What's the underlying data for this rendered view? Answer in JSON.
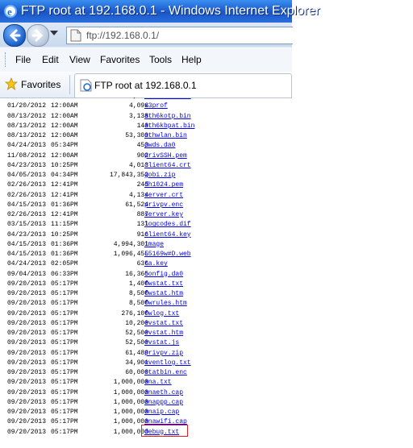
{
  "window": {
    "title": "FTP root at 192.168.0.1 - Windows Internet Explorer"
  },
  "address_bar": {
    "url": "ftp://192.168.0.1/"
  },
  "menu": [
    "File",
    "Edit",
    "View",
    "Favorites",
    "Tools",
    "Help"
  ],
  "favorites_bar": {
    "favorites_label": "Favorites"
  },
  "tab": {
    "title": "FTP root at 192.168.0.1"
  },
  "listing": [
    {
      "date": "08/13/2012",
      "time": "12:00AM",
      "size": "2,048",
      "name": "ath6kcal.bin"
    },
    {
      "date": "01/20/2012",
      "time": "12:00AM",
      "size": "4,096",
      "name": "x3prof"
    },
    {
      "date": "08/13/2012",
      "time": "12:00AM",
      "size": "3,138",
      "name": "ath6kotp.bin"
    },
    {
      "date": "08/13/2012",
      "time": "12:00AM",
      "size": "140",
      "name": "ath6kbpat.bin"
    },
    {
      "date": "08/13/2012",
      "time": "12:00AM",
      "size": "53,309",
      "name": "athwlan.bin"
    },
    {
      "date": "04/24/2013",
      "time": "05:34PM",
      "size": "453",
      "name": "pwds.da0"
    },
    {
      "date": "11/08/2012",
      "time": "12:00AM",
      "size": "902",
      "name": "privSSH.pem"
    },
    {
      "date": "04/23/2013",
      "time": "10:25PM",
      "size": "4,013",
      "name": "client64.crt"
    },
    {
      "date": "04/05/2013",
      "time": "04:34PM",
      "size": "17,843,352",
      "name": "gobi.zip"
    },
    {
      "date": "02/26/2013",
      "time": "12:41PM",
      "size": "245",
      "name": "dh1024.pem"
    },
    {
      "date": "02/26/2013",
      "time": "12:41PM",
      "size": "4,134",
      "name": "server.crt"
    },
    {
      "date": "04/15/2013",
      "time": "01:36PM",
      "size": "61,524",
      "name": "privpv.enc"
    },
    {
      "date": "02/26/2013",
      "time": "12:41PM",
      "size": "887",
      "name": "server.key"
    },
    {
      "date": "03/15/2013",
      "time": "11:15PM",
      "size": "131",
      "name": "logcodes.dif"
    },
    {
      "date": "04/23/2013",
      "time": "10:25PM",
      "size": "916",
      "name": "client64.key"
    },
    {
      "date": "04/15/2013",
      "time": "01:36PM",
      "size": "4,994,301",
      "name": "image"
    },
    {
      "date": "04/15/2013",
      "time": "01:36PM",
      "size": "1,096,455",
      "name": "L5169w#D.web"
    },
    {
      "date": "04/24/2013",
      "time": "02:05PM",
      "size": "636",
      "name": "ta.key"
    },
    {
      "date": "09/04/2013",
      "time": "06:33PM",
      "size": "16,365",
      "name": "config.da0"
    },
    {
      "date": "09/20/2013",
      "time": "05:17PM",
      "size": "1,400",
      "name": "fwstat.txt"
    },
    {
      "date": "09/20/2013",
      "time": "05:17PM",
      "size": "8,500",
      "name": "fwstat.htm"
    },
    {
      "date": "09/20/2013",
      "time": "05:17PM",
      "size": "8,500",
      "name": "fwrules.htm"
    },
    {
      "date": "09/20/2013",
      "time": "05:17PM",
      "size": "276,100",
      "name": "fwlog.txt"
    },
    {
      "date": "09/20/2013",
      "time": "05:17PM",
      "size": "10,200",
      "name": "evstat.txt"
    },
    {
      "date": "09/20/2013",
      "time": "05:17PM",
      "size": "52,500",
      "name": "evstat.htm"
    },
    {
      "date": "09/20/2013",
      "time": "05:17PM",
      "size": "52,500",
      "name": "evstat.js"
    },
    {
      "date": "09/20/2013",
      "time": "05:17PM",
      "size": "61,489",
      "name": "privpv.zip"
    },
    {
      "date": "09/20/2013",
      "time": "05:17PM",
      "size": "34,901",
      "name": "eventlog.txt"
    },
    {
      "date": "09/20/2013",
      "time": "05:17PM",
      "size": "60,000",
      "name": "statbin.enc"
    },
    {
      "date": "09/20/2013",
      "time": "05:17PM",
      "size": "1,000,000",
      "name": "ana.txt"
    },
    {
      "date": "09/20/2013",
      "time": "05:17PM",
      "size": "1,000,000",
      "name": "anaeth.cap"
    },
    {
      "date": "09/20/2013",
      "time": "05:17PM",
      "size": "1,000,000",
      "name": "anappp.cap"
    },
    {
      "date": "09/20/2013",
      "time": "05:17PM",
      "size": "1,000,000",
      "name": "anaip.cap"
    },
    {
      "date": "09/20/2013",
      "time": "05:17PM",
      "size": "1,000,000",
      "name": "anawifi.cap"
    },
    {
      "date": "09/20/2013",
      "time": "05:17PM",
      "size": "1,000,000",
      "name": "debug.txt",
      "highlighted": true
    }
  ],
  "colors": {
    "link": "#0000ee",
    "titlebar": "#1e5fd0",
    "highlight_box": "#e02020"
  },
  "icons": [
    "ie-logo-icon",
    "back-arrow-icon",
    "forward-arrow-icon",
    "page-icon",
    "favorites-star-icon",
    "ie-tab-icon"
  ]
}
